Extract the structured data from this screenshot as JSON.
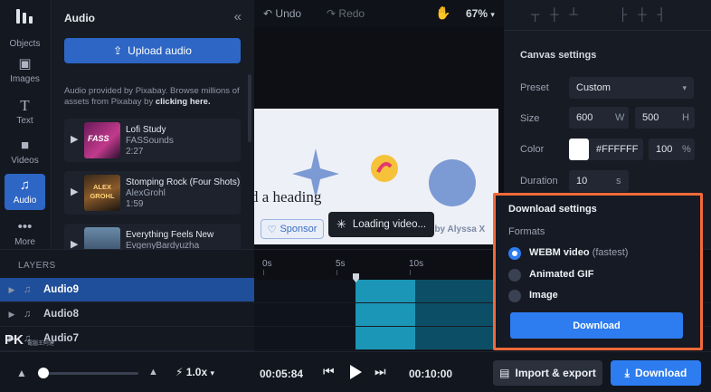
{
  "rail": {
    "items": [
      {
        "label": "Objects",
        "icon": "objects-icon"
      },
      {
        "label": "Images",
        "icon": "image-icon"
      },
      {
        "label": "Text",
        "icon": "text-icon"
      },
      {
        "label": "Videos",
        "icon": "video-icon"
      },
      {
        "label": "Audio",
        "icon": "music-note-icon"
      },
      {
        "label": "More",
        "icon": "more-dots-icon"
      }
    ],
    "active": "Audio"
  },
  "audio_panel": {
    "title": "Audio",
    "upload_label": "Upload audio",
    "note_prefix": "Audio provided by Pixabay. Browse millions of assets from Pixabay by ",
    "note_link": "clicking here.",
    "tracks": [
      {
        "name": "Lofi Study",
        "artist": "FASSounds",
        "duration": "2:27",
        "thumb_text": "FASS"
      },
      {
        "name": "Stomping Rock (Four Shots)",
        "artist": "AlexGrohl",
        "duration": "1:59",
        "thumb_text": "ALEX GROHL"
      },
      {
        "name": "Everything Feels New",
        "artist": "EvgenyBardyuzha",
        "duration": "",
        "thumb_text": ""
      }
    ]
  },
  "toolbar": {
    "undo": "Undo",
    "redo": "Redo",
    "zoom": "67%"
  },
  "canvas": {
    "heading_text": "d a heading",
    "sponsor_label": "Sponsor",
    "byline": "ed by Alyssa X",
    "loading_label": "Loading video..."
  },
  "settings": {
    "title": "Canvas settings",
    "preset_label": "Preset",
    "preset_value": "Custom",
    "size_label": "Size",
    "width": "600",
    "width_unit": "W",
    "height": "500",
    "height_unit": "H",
    "color_label": "Color",
    "color_value": "#FFFFFF",
    "opacity": "100",
    "opacity_unit": "%",
    "duration_label": "Duration",
    "duration_value": "10",
    "duration_unit": "s"
  },
  "layers": {
    "title": "LAYERS",
    "rows": [
      {
        "name": "Audio9",
        "selected": true
      },
      {
        "name": "Audio8",
        "selected": false
      },
      {
        "name": "Audio7",
        "selected": false
      }
    ],
    "watermark": "PK",
    "watermark_sub": "電腦王阿達"
  },
  "timeline": {
    "marks": [
      "0s",
      "5s",
      "10s"
    ]
  },
  "download_popup": {
    "title": "Download settings",
    "formats_label": "Formats",
    "options": [
      {
        "label": "WEBM video",
        "extra": "(fastest)",
        "selected": true
      },
      {
        "label": "Animated GIF",
        "extra": "",
        "selected": false
      },
      {
        "label": "Image",
        "extra": "",
        "selected": false
      }
    ],
    "button": "Download"
  },
  "bottom_bar": {
    "speed": "1.0x",
    "current_time": "00:05:84",
    "total_time": "00:10:00",
    "import_export": "Import & export",
    "download": "Download",
    "slider_value": 0.02
  },
  "colors": {
    "accent": "#2d7cf0",
    "highlight_border": "#f26a3a",
    "clip": "#1b96b6"
  }
}
